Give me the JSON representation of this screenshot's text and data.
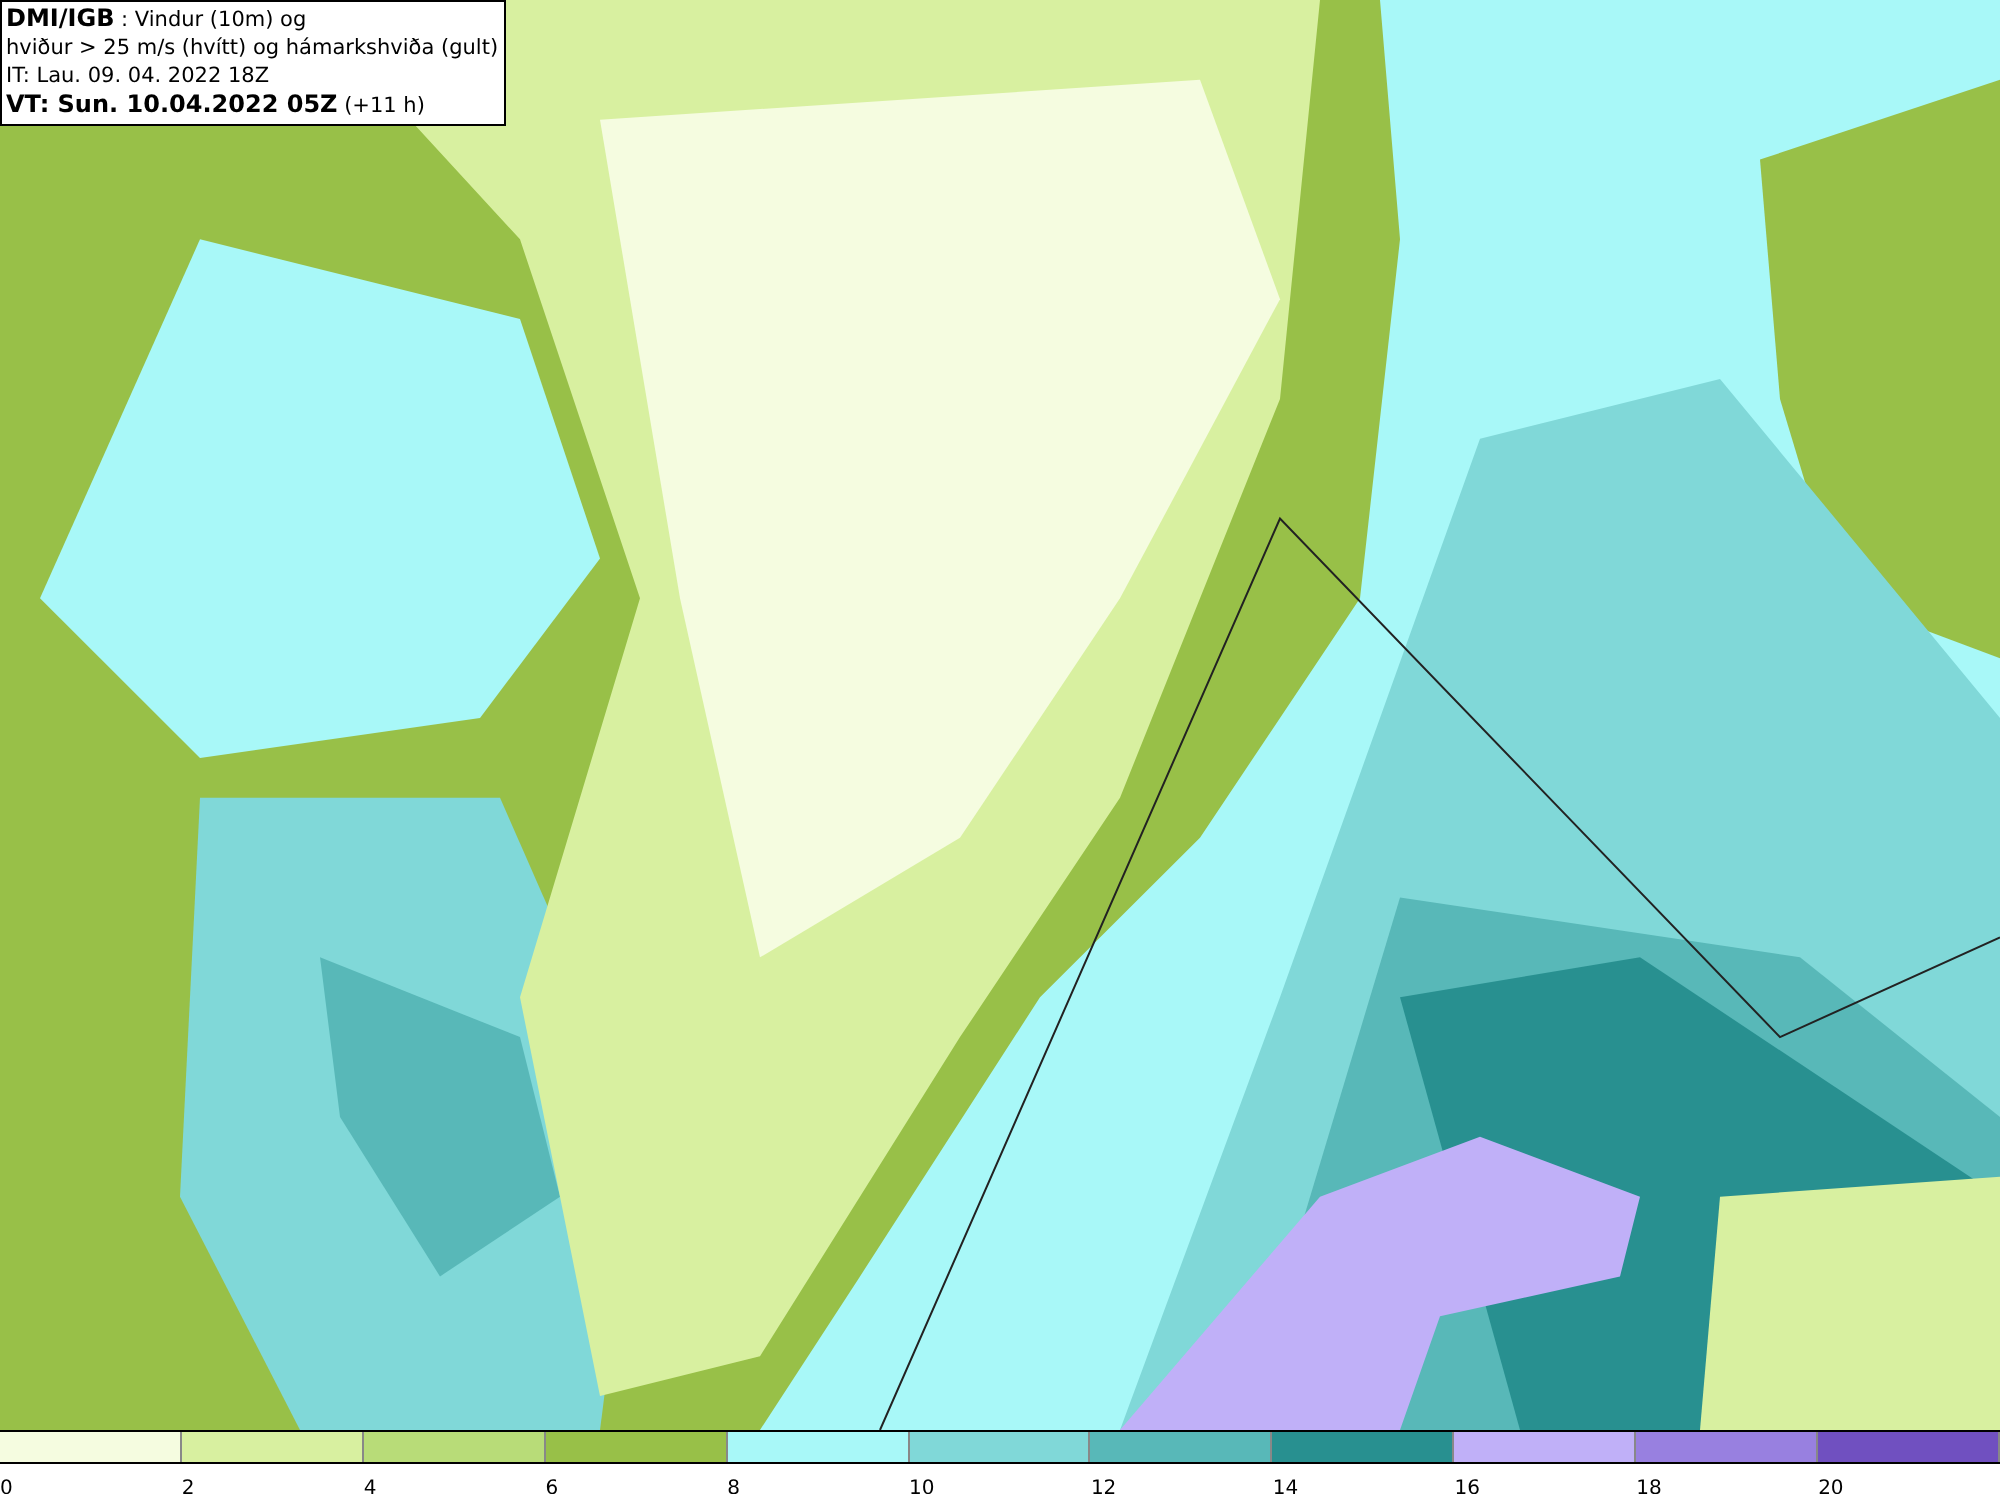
{
  "header": {
    "lines": [
      "**DMI/IGB** : Vindur (10m) og",
      "hviður > 25 m/s (hvítt) og hámarkshviða (gult)",
      "IT: Lau. 09. 04. 2022 18Z",
      "**VT: Sun. 10.04.2022 05Z** (+11 h)"
    ]
  },
  "legend": {
    "bins": [
      {
        "color": "#f5fce0",
        "label": "0"
      },
      {
        "color": "#d8f0a0",
        "label": "2"
      },
      {
        "color": "#b8dc78",
        "label": "4"
      },
      {
        "color": "#98c048",
        "label": "6"
      },
      {
        "color": "#a8f8f8",
        "label": "8"
      },
      {
        "color": "#80d8d8",
        "label": "10"
      },
      {
        "color": "#58b8b8",
        "label": "12"
      },
      {
        "color": "#289090",
        "label": "14"
      },
      {
        "color": "#c0b0f8",
        "label": "16"
      },
      {
        "color": "#9880e0",
        "label": "18"
      },
      {
        "color": "#7050c0",
        "label": "20"
      }
    ]
  }
}
